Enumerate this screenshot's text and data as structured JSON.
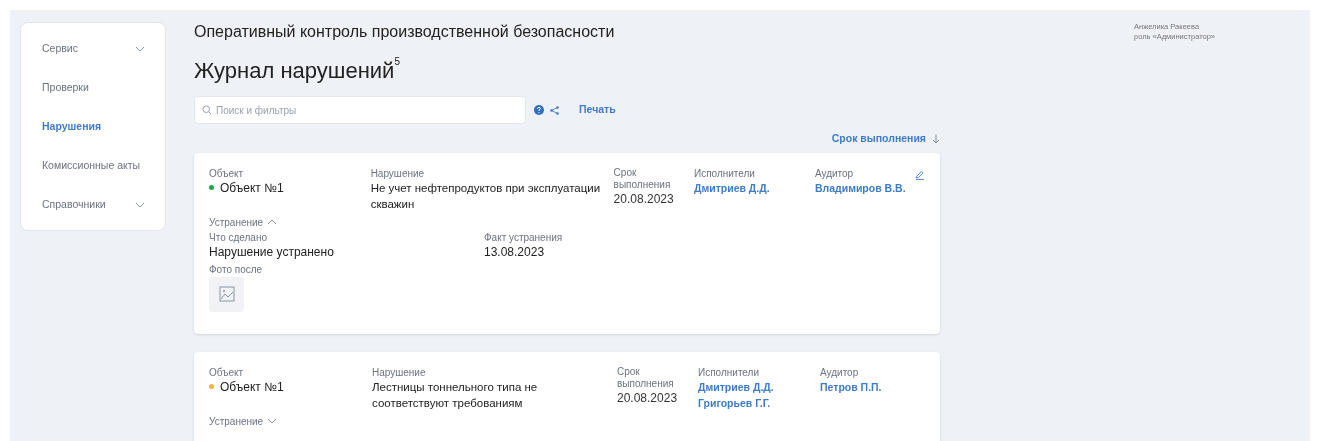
{
  "sidebar": {
    "items": [
      {
        "label": "Сервис",
        "selected": false,
        "expandable": true
      },
      {
        "label": "Проверки",
        "selected": false,
        "expandable": false
      },
      {
        "label": "Нарушения",
        "selected": true,
        "expandable": false
      },
      {
        "label": "Комиссионные акты",
        "selected": false,
        "expandable": false
      },
      {
        "label": "Справочники",
        "selected": false,
        "expandable": true
      }
    ]
  },
  "app_title": "Оперативный контроль производственной безопасности",
  "user": {
    "name": "Анжелика Ракеева",
    "role": "роль «Администратор»"
  },
  "page": {
    "title": "Журнал нарушений",
    "count": "5"
  },
  "search": {
    "placeholder": "Поиск и фильтры"
  },
  "print_link": "Печать",
  "sort": {
    "label": "Срок выполнения"
  },
  "cards": [
    {
      "object_label": "Объект",
      "object": "Объект №1",
      "color": "#22a34a",
      "violation_label": "Нарушение",
      "violation": "Не учет нефтепродуктов при эксплуатации скважин",
      "deadline_label": "Срок выполнения",
      "deadline": "20.08.2023",
      "executors_label": "Исполнители",
      "executors": [
        "Дмитриев Д.Д."
      ],
      "auditor_label": "Аудитор",
      "auditor": "Владимиров В.В.",
      "editable": true,
      "fix_label": "Устранение",
      "expanded": true,
      "details": {
        "done_label": "Что сделано",
        "done": "Нарушение устранено",
        "fact_label": "Факт устранения",
        "fact": "13.08.2023",
        "photo_label": "Фото после"
      }
    },
    {
      "object_label": "Объект",
      "object": "Объект №1",
      "color": "#f2b441",
      "violation_label": "Нарушение",
      "violation": "Лестницы тоннельного типа не соответствуют требованиям",
      "deadline_label": "Срок выполнения",
      "deadline": "20.08.2023",
      "executors_label": "Исполнители",
      "executors": [
        "Дмитриев Д.Д.",
        "Григорьев Г.Г."
      ],
      "auditor_label": "Аудитор",
      "auditor": "Петров П.П.",
      "editable": false,
      "fix_label": "Устранение",
      "expanded": false
    }
  ]
}
